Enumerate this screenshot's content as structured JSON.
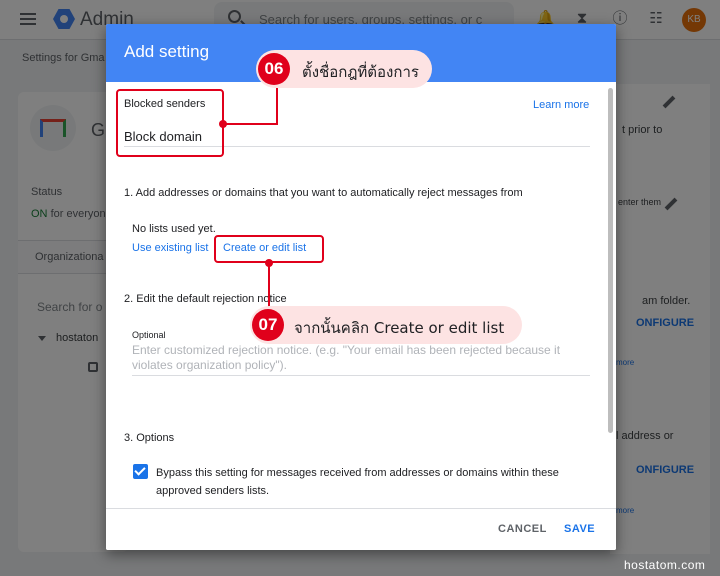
{
  "topbar": {
    "app_title": "Admin",
    "search_placeholder": "Search for users, groups, settings, or c",
    "avatar_initials": "KB",
    "icons": [
      "menu-icon",
      "admin-logo-icon",
      "search-icon",
      "bell-icon",
      "hourglass-icon",
      "help-icon",
      "apps-grid-icon"
    ]
  },
  "breadcrumb": "Settings for Gma",
  "left_panel": {
    "app_letter": "G",
    "status_label": "Status",
    "status_on": "ON",
    "status_rest": "for everyone",
    "org_label": "Organizationa",
    "search_placeholder": "Search for o",
    "tree_item": "hostaton"
  },
  "right_panel": {
    "text_1": "t prior to",
    "text_2": "enter them",
    "text_3": "am folder.",
    "configure_1": "ONFIGURE",
    "more_1": "more",
    "text_4": "l address or",
    "configure_2": "ONFIGURE",
    "more_2": "more"
  },
  "dialog": {
    "title": "Add setting",
    "field_label": "Blocked senders",
    "field_value": "Block domain",
    "learn_more": "Learn more",
    "section1": "1. Add addresses or domains that you want to automatically reject messages from",
    "no_lists": "No lists used yet.",
    "use_existing": "Use existing list",
    "create_edit": "Create or edit list",
    "section2": "2. Edit the default rejection notice",
    "optional": "Optional",
    "rejection_placeholder": "Enter customized rejection notice. (e.g. \"Your email has been rejected because it violates organization policy\").",
    "section3": "3. Options",
    "bypass_checked": true,
    "bypass_text": "Bypass this setting for messages received from addresses or domains within these approved senders lists.",
    "cancel": "CANCEL",
    "save": "SAVE"
  },
  "callouts": [
    {
      "number": "06",
      "text": "ตั้งชื่อกฎที่ต้องการ"
    },
    {
      "number": "07",
      "text": "จากนั้นคลิก Create or edit list"
    }
  ],
  "watermark": "hostatom.com",
  "colors": {
    "header_blue": "#4285f4",
    "link_blue": "#1a73e8",
    "highlight_red": "#e0001b",
    "callout_bg": "#fde3e3"
  }
}
